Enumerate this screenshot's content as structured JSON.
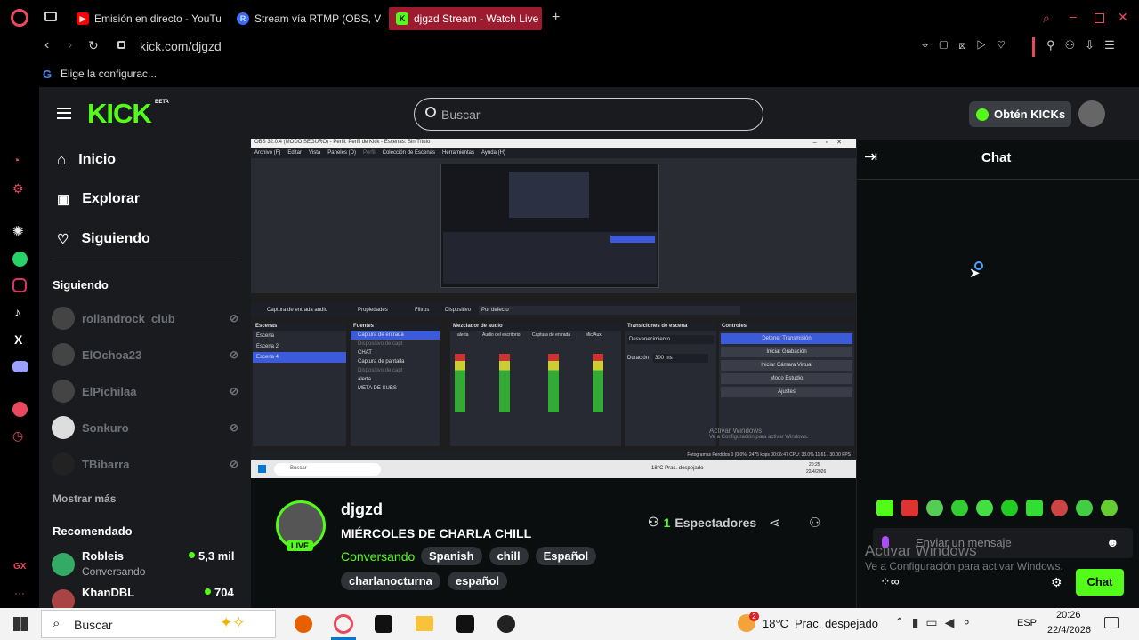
{
  "browser": {
    "tabs": [
      {
        "label": "Emisión en directo - YouTu",
        "icon": "youtube-icon",
        "color": "#ff0000"
      },
      {
        "label": "Stream vía RTMP (OBS, V",
        "icon": "restream-icon",
        "color": "#3b6cf5"
      },
      {
        "label": "djgzd Stream - Watch Live",
        "icon": "kick-icon",
        "color": "#53fc18"
      }
    ],
    "address": "kick.com/djgzd",
    "bookmark": "Elige la configurac..."
  },
  "kick": {
    "logo": "KICK",
    "logo_badge": "BETA",
    "search_placeholder": "Buscar",
    "get_kicks": "Obtén KICKs",
    "nav": {
      "home": "Inicio",
      "explore": "Explorar",
      "following": "Siguiendo"
    },
    "following_heading": "Siguiendo",
    "following": [
      "rollandrock_club",
      "ElOchoa23",
      "ElPichilaa",
      "Sonkuro",
      "TBibarra"
    ],
    "show_more": "Mostrar más",
    "recommended_heading": "Recomendado",
    "recommended": [
      {
        "name": "Robleis",
        "category": "Conversando",
        "viewers": "5,3 mil"
      },
      {
        "name": "KhanDBL",
        "category": "",
        "viewers": "704"
      }
    ],
    "channel": {
      "name": "djgzd",
      "title": "MIÉRCOLES DE CHARLA CHILL",
      "category": "Conversando",
      "live_badge": "LIVE",
      "tags": [
        "Spanish",
        "chill",
        "Español",
        "charlanocturna",
        "español"
      ],
      "viewers_count": "1",
      "viewers_label": "Espectadores"
    },
    "chat": {
      "title": "Chat",
      "placeholder": "Enviar un mensaje",
      "send_button": "Chat"
    },
    "watermark": {
      "line1": "Activar Windows",
      "line2": "Ve a Configuración para activar Windows."
    }
  },
  "obs": {
    "window_title": "OBS 32.0.4 (MODO SEGURO) - Perfil: Perfil de Kick - Escenas: Sin Título",
    "menu": [
      "Archivo (F)",
      "Editar",
      "Vista",
      "Paneles (D)",
      "Perfil",
      "Colección de Escenas",
      "Herramientas",
      "Ayuda (H)"
    ],
    "source_bar": {
      "source": "Captura de entrada audio",
      "properties": "Propiedades",
      "filters": "Filtros",
      "device_label": "Dispositivo",
      "device_value": "Por defecto"
    },
    "panels": {
      "scenes": "Escenas",
      "sources": "Fuentes",
      "mixer": "Mezclador de audio",
      "transitions": "Transiciones de escena",
      "controls": "Controles"
    },
    "scenes": [
      "Escena",
      "Escena 2",
      "Escena 4"
    ],
    "sources": [
      "Captura de entrada",
      "Dispositivo de capt",
      "CHAT",
      "Captura de pantalla",
      "Dispositivo de capt",
      "alerta",
      "META DE SUBS"
    ],
    "mixer_channels": [
      "alerta",
      "Audio del escritorio",
      "Captura de entrada",
      "Mic/Aux"
    ],
    "transition": {
      "type": "Desvanecimiento",
      "duration_label": "Duración",
      "duration": "300 ms"
    },
    "controls": [
      "Detener Transmisión",
      "Iniciar Grabación",
      "Iniciar Cámara Virtual",
      "Modo Estudio",
      "Ajustes"
    ],
    "status": "Fotogramas Perdidos 0 (0.0%)   2475 kbps   00:05:47   CPU: 33.0%   11.61 / 30.00 FPS",
    "watermark": {
      "line1": "Activar Windows",
      "line2": "Ve a Configuración para activar Windows."
    },
    "taskbar_search": "Buscar",
    "weather": "18°C  Prac. despejado",
    "clock": "20:25",
    "date": "22/4/2026"
  },
  "taskbar": {
    "search": "Buscar",
    "weather_temp": "18°C",
    "weather_text": "Prac. despejado",
    "lang": "ESP",
    "time": "20:26",
    "date": "22/4/2026",
    "notif_count": "2"
  }
}
